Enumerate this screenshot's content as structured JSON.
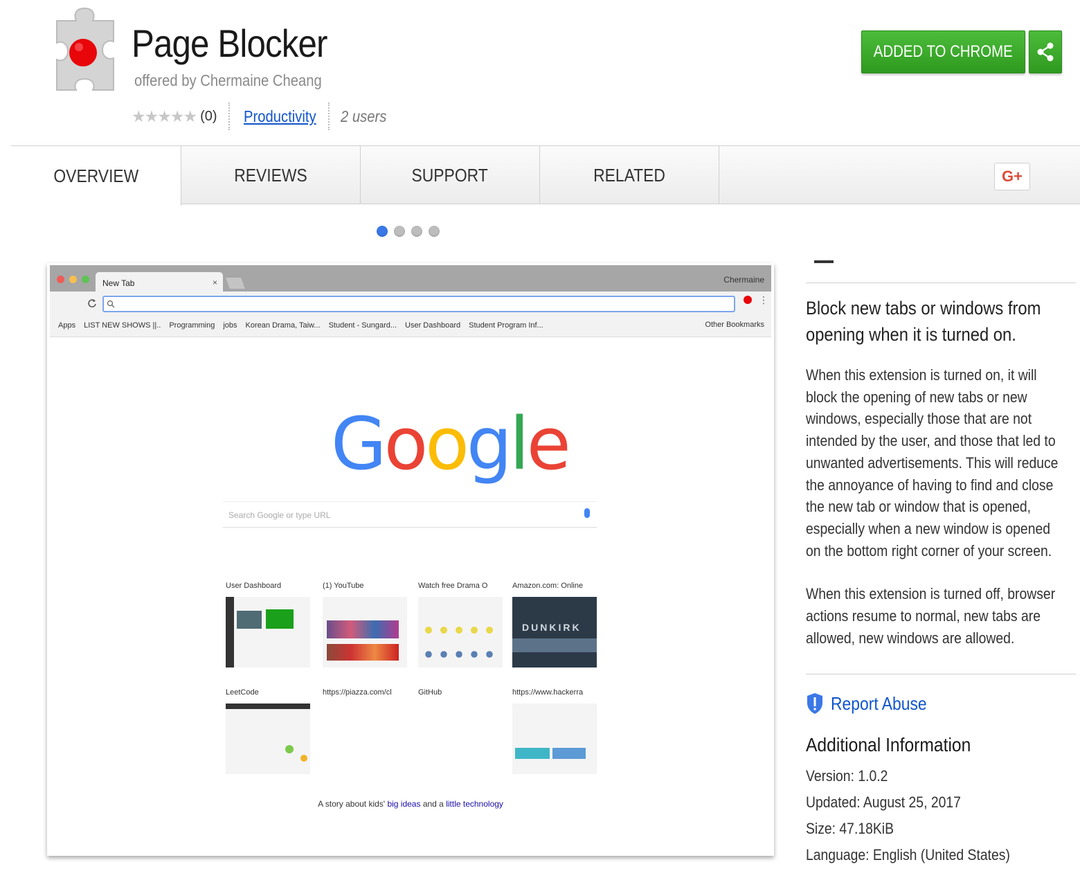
{
  "header": {
    "title": "Page Blocker",
    "offered_by": "offered by Chermaine Cheang",
    "stars": "★★★★★",
    "rating_count": "(0)",
    "category": "Productivity",
    "users": "2 users",
    "add_button": "ADDED TO CHROME",
    "share_icon": "share-icon"
  },
  "tabs": [
    {
      "label": "OVERVIEW"
    },
    {
      "label": "REVIEWS"
    },
    {
      "label": "SUPPORT"
    },
    {
      "label": "RELATED"
    }
  ],
  "gplus_label": "G+",
  "carousel": {
    "count": 4,
    "active_index": 0
  },
  "screenshot": {
    "tab_title": "New Tab",
    "tab_close": "×",
    "profile_name": "Chermaine",
    "bookmarks": [
      "Apps",
      "LIST NEW SHOWS ||..",
      "Programming",
      "jobs",
      "Korean Drama, Taiw...",
      "Student - Sungard...",
      "User Dashboard",
      "Student Program Inf..."
    ],
    "other_bookmarks": "Other Bookmarks",
    "google_logo": "Google",
    "search_placeholder": "Search Google or type URL",
    "tiles": [
      {
        "label": "User Dashboard"
      },
      {
        "label": "(1) YouTube"
      },
      {
        "label": "Watch free Drama O"
      },
      {
        "label": "Amazon.com: Online"
      },
      {
        "label": "LeetCode"
      },
      {
        "label": "https://piazza.com/cl"
      },
      {
        "label": "GitHub"
      },
      {
        "label": "https://www.hackerra"
      }
    ],
    "thumb_text": "DUNKIRK",
    "story_prefix": "A story about kids'",
    "story_link1": "big ideas",
    "story_mid": "and a",
    "story_link2": "little technology"
  },
  "sidebar": {
    "summary": "Block new tabs or windows from opening when it is turned on.",
    "desc1": "When this extension is turned on, it will block the opening of new tabs or new windows, especially those that are not intended by the user, and those that led to unwanted advertisements. This will reduce the annoyance of having to find and close the new tab or window that is opened, especially when a new window is opened on the bottom right corner of your screen.",
    "desc2": "When this extension is turned off, browser actions resume to normal, new tabs are allowed, new windows are allowed.",
    "report_abuse": "Report Abuse",
    "additional_title": "Additional Information",
    "version": "Version: 1.0.2",
    "updated": "Updated: August 25, 2017",
    "size": "Size: 47.18KiB",
    "language": "Language: English (United States)"
  },
  "colors": {
    "accent_green": "#3aa52a",
    "link_blue": "#1155cc",
    "dot_active": "#3b78e7"
  }
}
